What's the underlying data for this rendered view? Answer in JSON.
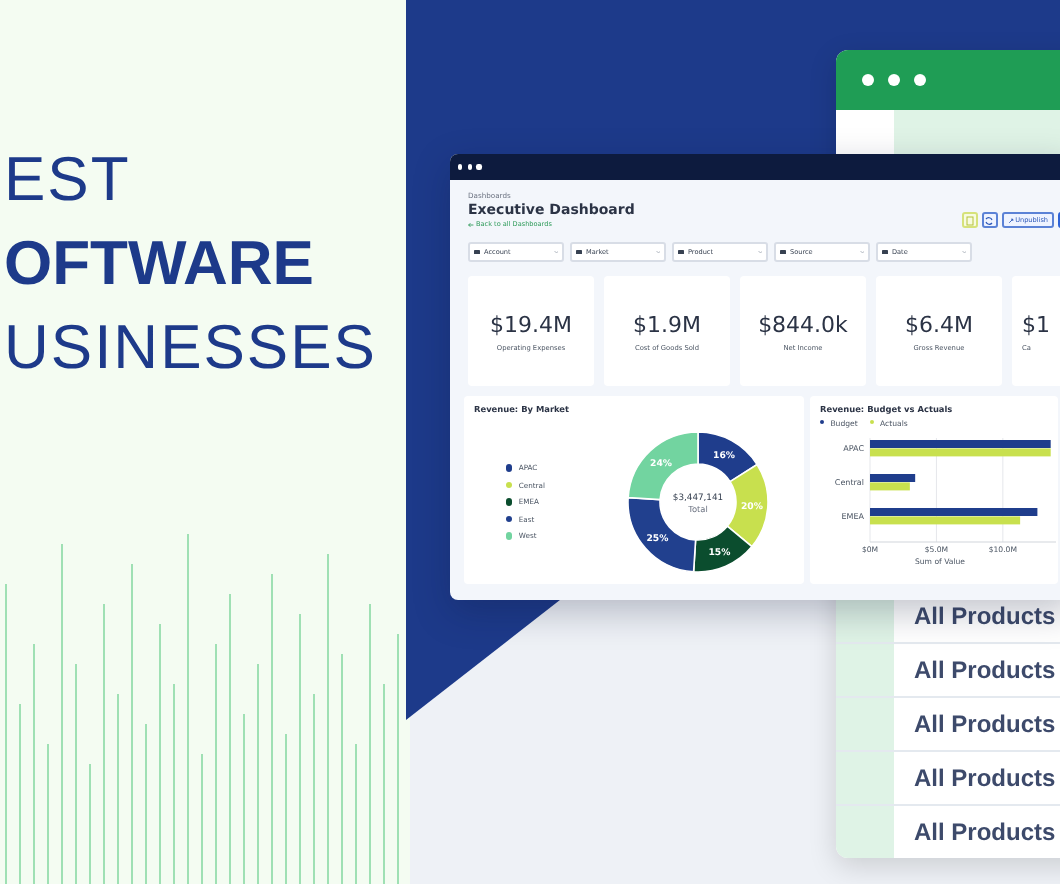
{
  "headline": {
    "lines": [
      {
        "text": "EST",
        "bold": false
      },
      {
        "text": "OFTWARE",
        "bold": true
      },
      {
        "text": "USINESSES",
        "bold": false
      }
    ]
  },
  "back_window": {
    "rows": [
      "All Products",
      "All Products",
      "All Products",
      "All Products",
      "All Products"
    ]
  },
  "dashboard": {
    "breadcrumb": "Dashboards",
    "title": "Executive Dashboard",
    "back_link": "Back to all Dashboards",
    "unpublish_button": "Unpublish",
    "filters": [
      "Account",
      "Market",
      "Product",
      "Source",
      "Date"
    ],
    "kpis": [
      {
        "value": "$19.4M",
        "label": "Operating Expenses"
      },
      {
        "value": "$1.9M",
        "label": "Cost of Goods Sold"
      },
      {
        "value": "$844.0k",
        "label": "Net Income"
      },
      {
        "value": "$6.4M",
        "label": "Gross Revenue"
      },
      {
        "value": "$1",
        "label": "Ca"
      }
    ],
    "market_panel": {
      "title": "Revenue: By Market",
      "total": "$3,447,141",
      "total_label": "Total",
      "legend": [
        {
          "color": "#1f3d8c"
        },
        {
          "color": "#c8e04e"
        },
        {
          "color": "#0b4d2e"
        },
        {
          "color": "#21408e"
        },
        {
          "color": "#72d4a0"
        }
      ],
      "chart_data": {
        "type": "donut",
        "categories": [
          "APAC",
          "Central",
          "EMEA",
          "East",
          "West"
        ],
        "values": [
          16,
          20,
          15,
          25,
          24
        ],
        "value_labels": [
          "16%",
          "20%",
          "15%",
          "25%",
          "24%"
        ]
      }
    },
    "budget_panel": {
      "title": "Revenue: Budget vs Actuals",
      "chart_data": {
        "type": "bar",
        "orientation": "horizontal",
        "xlabel": "Sum of Value",
        "categories": [
          "APAC",
          "Central",
          "EMEA"
        ],
        "series": [
          {
            "name": "Budget",
            "color": "#1f3d8c",
            "values": [
              13.6,
              3.4,
              12.6
            ]
          },
          {
            "name": "Actuals",
            "color": "#c8e04e",
            "values": [
              13.6,
              3.0,
              11.3
            ]
          }
        ],
        "xlim": [
          0,
          14
        ],
        "xticks": [
          {
            "value": 0,
            "label": "$0M"
          },
          {
            "value": 5,
            "label": "$5.0M"
          },
          {
            "value": 10,
            "label": "$10.0M"
          }
        ]
      }
    }
  }
}
